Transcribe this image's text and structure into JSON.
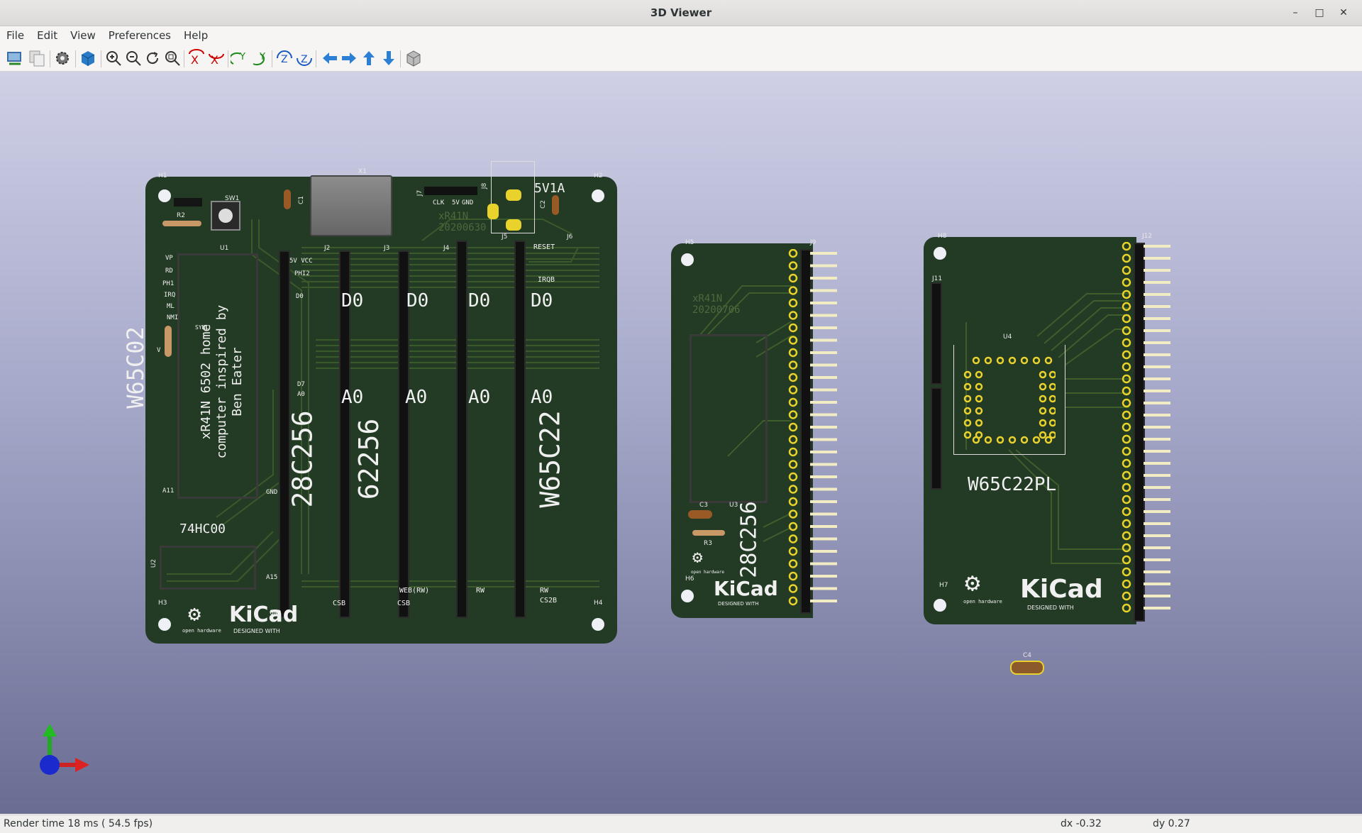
{
  "window": {
    "title": "3D Viewer",
    "controls": [
      "minimize-icon",
      "maximize-icon",
      "close-icon"
    ]
  },
  "menu": [
    "File",
    "Edit",
    "View",
    "Preferences",
    "Help"
  ],
  "toolbar_icons": [
    "reload-board-icon",
    "copy-image-icon",
    "settings-icon",
    "raytracing-icon",
    "zoom-in-icon",
    "zoom-out-icon",
    "redraw-icon",
    "zoom-fit-icon",
    "rotate-x-ccw-icon",
    "rotate-x-cw-icon",
    "rotate-y-ccw-icon",
    "rotate-y-cw-icon",
    "rotate-z-ccw-icon",
    "rotate-z-cw-icon",
    "move-left-icon",
    "move-right-icon",
    "move-up-icon",
    "move-down-icon",
    "ortho-view-icon"
  ],
  "colors": {
    "pcb": "#233a25",
    "silkscreen": "#f0f0f0",
    "pad": "#e9d22c",
    "bg_top": "#cfd0e6",
    "bg_bottom": "#6a6d92"
  },
  "board1": {
    "refs": {
      "h1": "H1",
      "h2": "H2",
      "h3": "H3",
      "h4": "H4",
      "sw1": "SW1",
      "r2": "R2",
      "u1": "U1",
      "c1": "C1",
      "x1": "X1",
      "j7": "J7",
      "j8": "J8",
      "c2": "C2",
      "j2": "J2",
      "j3": "J3",
      "j4": "J4",
      "j5": "J5",
      "j6": "J6",
      "u2": "U2"
    },
    "labels": {
      "cpu": "W65C02",
      "u1_text": "xR41N 6502 home computer inspired by Ben Eater",
      "gate": "74HC00",
      "rom": "28C256",
      "ram": "62256",
      "via": "W65C22",
      "d0": "D0",
      "a0": "A0",
      "power": "5V1A",
      "name": "xR41N",
      "date": "20200630",
      "clk": "CLK",
      "j7_5v": "5V",
      "j7_gnd": "GND",
      "reset": "RESET",
      "irqb": "IRQB",
      "vp": "VP",
      "rd": "RD",
      "phi": "PH1",
      "irq": "IRQ",
      "ml": "ML",
      "nmi": "NMI",
      "vcc": "5V VCC",
      "phi2": "PHI2",
      "d0b": "D0",
      "d7": "D7",
      "a0b": "A0",
      "a11": "A11",
      "gnd": "GND",
      "a15": "A15",
      "gnd2": "GND",
      "csb1": "CSB",
      "csb2": "CSB",
      "web": "WEB(RW)",
      "rw1": "RW",
      "rw2": "RW",
      "cs2b": "CS2B",
      "sync": "SYNC",
      "v": "V"
    }
  },
  "board2": {
    "refs": {
      "h5": "H5",
      "h6": "H6",
      "j9": "J9",
      "u3": "U3",
      "c3": "C3",
      "r3": "R3"
    },
    "labels": {
      "rom": "28C256",
      "name": "xR41N",
      "date": "20200706"
    }
  },
  "board3": {
    "refs": {
      "h8": "H8",
      "h7": "H7",
      "j11": "J11",
      "j12": "J12",
      "u4": "U4",
      "c4": "C4"
    },
    "labels": {
      "chip": "W65C22PL"
    }
  },
  "logos": {
    "kicad": "KiCad",
    "designed_with": "DESIGNED WITH",
    "oshw": "open hardware"
  },
  "status": {
    "render_time": "Render time 18 ms ( 54.5 fps)",
    "dx": "dx -0.32",
    "dy": "dy 0.27"
  }
}
